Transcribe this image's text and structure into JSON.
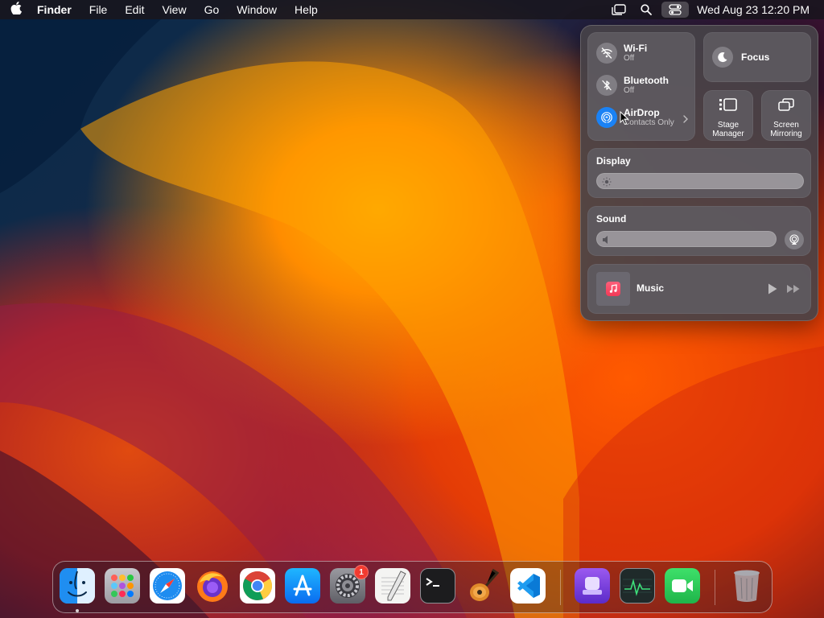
{
  "menubar": {
    "app_name": "Finder",
    "items": [
      "File",
      "Edit",
      "View",
      "Go",
      "Window",
      "Help"
    ],
    "clock": "Wed Aug 23  12:20 PM"
  },
  "control_center": {
    "wifi": {
      "title": "Wi-Fi",
      "status": "Off"
    },
    "bluetooth": {
      "title": "Bluetooth",
      "status": "Off"
    },
    "airdrop": {
      "title": "AirDrop",
      "status": "Contacts Only"
    },
    "focus": {
      "label": "Focus"
    },
    "stage_manager": {
      "label_line1": "Stage",
      "label_line2": "Manager"
    },
    "screen_mirroring": {
      "label_line1": "Screen",
      "label_line2": "Mirroring"
    },
    "display": {
      "title": "Display",
      "level": 1.0
    },
    "sound": {
      "title": "Sound",
      "level": 1.0
    },
    "music": {
      "label": "Music"
    }
  },
  "dock": {
    "apps": [
      "finder-icon",
      "launchpad-icon",
      "safari-icon",
      "firefox-icon",
      "chrome-icon",
      "app-store-icon",
      "system-settings-icon",
      "textedit-icon",
      "terminal-icon",
      "garageband-icon",
      "vscode-icon",
      "automator-icon",
      "activity-monitor-icon",
      "facetime-icon",
      "trash-icon"
    ],
    "settings_badge": "1"
  },
  "colors": {
    "accent_blue": "#1a82f5",
    "badge_red": "#f23b30"
  }
}
